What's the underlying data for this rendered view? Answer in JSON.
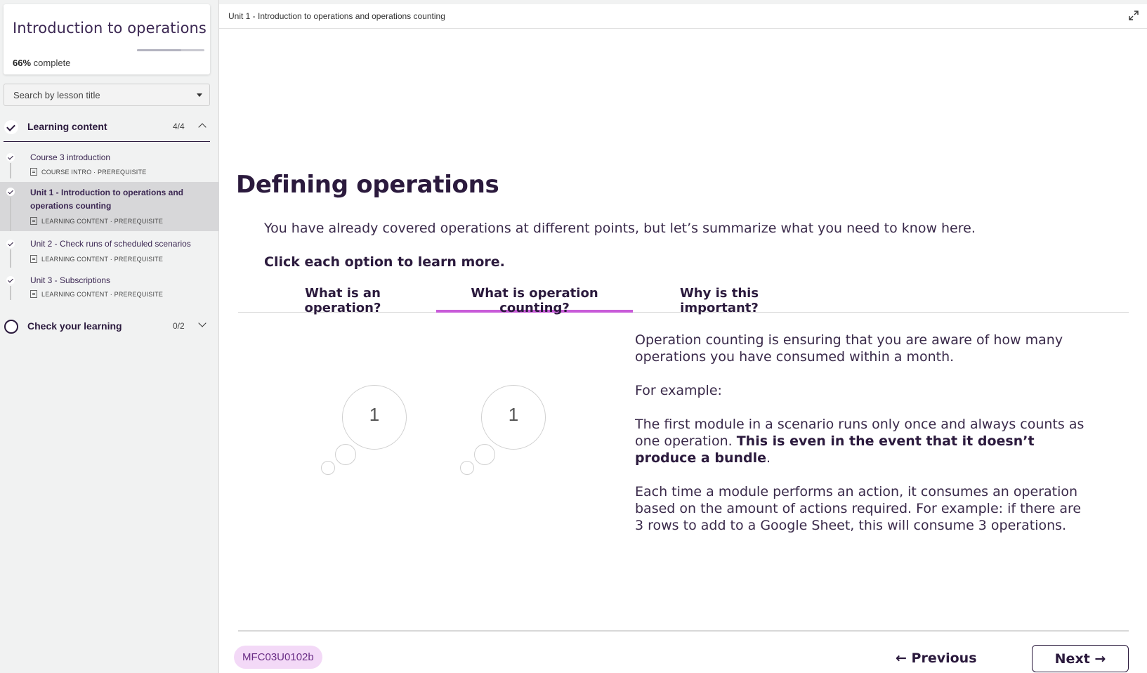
{
  "sidebar": {
    "course_title": "Introduction to operations",
    "progress_percent": 66,
    "progress_label": "66%",
    "complete_suffix": "complete",
    "search_placeholder": "Search by lesson title",
    "sections": [
      {
        "label": "Learning content",
        "count": "4/4",
        "completed": true,
        "expanded": true,
        "lessons": [
          {
            "title": "Course 3 introduction",
            "meta": "COURSE INTRO · PREREQUISITE",
            "completed": true
          },
          {
            "title": "Unit 1 - Introduction to operations and operations counting",
            "meta": "LEARNING CONTENT · PREREQUISITE",
            "completed": true,
            "active": true
          },
          {
            "title": "Unit 2 - Check runs of scheduled scenarios",
            "meta": "LEARNING CONTENT · PREREQUISITE",
            "completed": true
          },
          {
            "title": "Unit 3 - Subscriptions",
            "meta": "LEARNING CONTENT · PREREQUISITE",
            "completed": true
          }
        ]
      },
      {
        "label": "Check your learning",
        "count": "0/2",
        "completed": false,
        "expanded": false
      }
    ]
  },
  "main": {
    "breadcrumb": "Unit 1 - Introduction to operations and operations counting",
    "title": "Defining operations",
    "intro": "You have already covered operations at different points, but let’s summarize what you need to know here.",
    "instruction": "Click each option to learn more.",
    "tabs": [
      {
        "label": "What is an operation?"
      },
      {
        "label": "What is operation counting?",
        "active": true
      },
      {
        "label": "Why is this important?"
      }
    ],
    "illustration": {
      "bubble_values": [
        "1",
        "1"
      ]
    },
    "content": {
      "p1": "Operation counting is ensuring that you are aware of how many operations you have consumed within a month.",
      "p2": "For example:",
      "p3_plain": "The first module in a scenario runs only once and always counts as one operation.",
      "p3_bold": "This is even in the event that it doesn’t produce a bundle",
      "p3_end": ".",
      "p4": "Each time a module performs an action, it consumes an operation based on the amount of actions required. For example: if there are 3 rows to add to a Google Sheet, this will consume 3 operations."
    },
    "footer": {
      "code": "MFC03U0102b",
      "prev_label": "← Previous",
      "next_label": "Next →"
    }
  },
  "colors": {
    "accent_tab": "#c85bd8",
    "badge_bg": "#f3d9f7",
    "text_dark": "#2b1a3d"
  }
}
